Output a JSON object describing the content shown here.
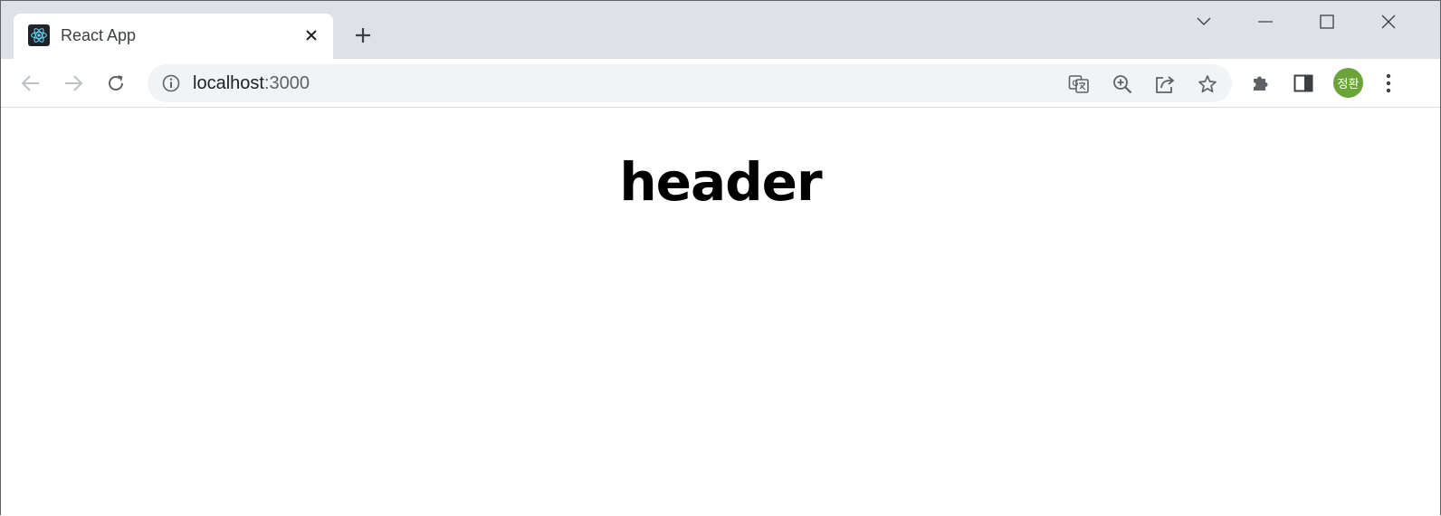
{
  "browser": {
    "tab": {
      "title": "React App",
      "favicon": "react-logo-icon"
    },
    "window_controls": [
      "tab-search-icon",
      "minimize-icon",
      "maximize-icon",
      "close-window-icon"
    ],
    "toolbar": {
      "url_host": "localhost",
      "url_port": ":3000",
      "avatar_text": "정환",
      "avatar_color": "#6aa43a"
    }
  },
  "page": {
    "header": "header"
  }
}
